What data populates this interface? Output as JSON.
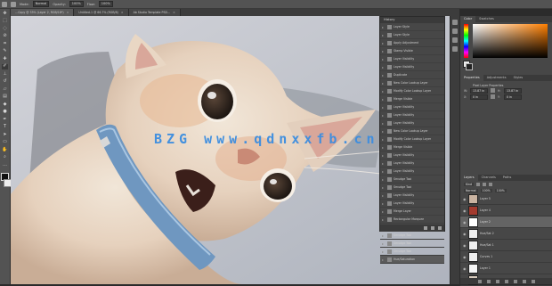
{
  "options_bar": {
    "mode_label": "Mode:",
    "mode_value": "Normal",
    "opacity_label": "Opacity:",
    "opacity_value": "100%",
    "flow_label": "Flow:",
    "flow_value": "100%"
  },
  "tabs": [
    {
      "label": "…Copy @ 33% (Layer 2, RGB/16*)",
      "close": "×"
    },
    {
      "label": "Untitled-1 @ 66.7% (RGB/8)",
      "close": "×"
    },
    {
      "label": "Ab Studio Template PSD…",
      "close": "×"
    }
  ],
  "watermark": {
    "text": "BZG www.qdnxxfb.cn"
  },
  "history_panel": {
    "title": "History",
    "items": [
      {
        "label": "Layer Style"
      },
      {
        "label": "Layer Style"
      },
      {
        "label": "Apply Adjustment"
      },
      {
        "label": "Stamp Visible"
      },
      {
        "label": "Layer Visibility"
      },
      {
        "label": "Layer Visibility"
      },
      {
        "label": "Duplicate"
      },
      {
        "label": "New Color Lookup Layer"
      },
      {
        "label": "Modify Color Lookup Layer"
      },
      {
        "label": "Merge Visible"
      },
      {
        "label": "Layer Visibility"
      },
      {
        "label": "Layer Visibility"
      },
      {
        "label": "Layer Visibility"
      },
      {
        "label": "New Color Lookup Layer"
      },
      {
        "label": "Modify Color Lookup Layer"
      },
      {
        "label": "Merge Visible"
      },
      {
        "label": "Layer Visibility"
      },
      {
        "label": "Layer Visibility"
      },
      {
        "label": "Layer Visibility"
      },
      {
        "label": "Smudge Tool"
      },
      {
        "label": "Smudge Tool"
      },
      {
        "label": "Layer Visibility"
      },
      {
        "label": "Layer Visibility"
      },
      {
        "label": "Merge Layer"
      },
      {
        "label": "Rectangular Marquee"
      },
      {
        "label": "Smudge Tool"
      },
      {
        "label": "Smudge Tool"
      },
      {
        "label": "Smudge Tool"
      },
      {
        "label": "Smudge Tool"
      },
      {
        "label": "Hue/Saturation"
      }
    ],
    "selected_index": 29
  },
  "color_panel": {
    "tabs": [
      "Color",
      "Swatches"
    ]
  },
  "properties_panel": {
    "tabs": [
      "Properties",
      "Adjustments",
      "Styles"
    ],
    "subtitle": "Pixel Layer Properties",
    "w_label": "W:",
    "w_value": "13.87 in",
    "h_label": "H:",
    "h_value": "13.87 in",
    "x_label": "X:",
    "x_value": "0 in",
    "y_label": "Y:",
    "y_value": "0 in"
  },
  "layers_panel": {
    "tabs": [
      "Layers",
      "Channels",
      "Paths"
    ],
    "kind_label": "Kind",
    "blend_value": "Normal",
    "opacity_value": "100%",
    "fill_value": "100%",
    "layers": [
      {
        "name": "Layer 5",
        "thumb_color": "#c9b3a1"
      },
      {
        "name": "Layer 4",
        "thumb_color": "#a33a2e"
      },
      {
        "name": "Layer 2",
        "thumb_color": "#ffffff"
      },
      {
        "name": "Hue/Sat 2",
        "thumb_color": "#eeeeee"
      },
      {
        "name": "Hue/Sat 1",
        "thumb_color": "#eeeeee"
      },
      {
        "name": "Curves 1",
        "thumb_color": "#eeeeee"
      },
      {
        "name": "Layer 1",
        "thumb_color": "#f5f5f5"
      },
      {
        "name": "Layer 0",
        "thumb_color": "#d8cbbd"
      }
    ],
    "selected_index": 2
  },
  "colors": {
    "panel_bg": "#474747",
    "accent_watermark": "#3b8de0"
  }
}
